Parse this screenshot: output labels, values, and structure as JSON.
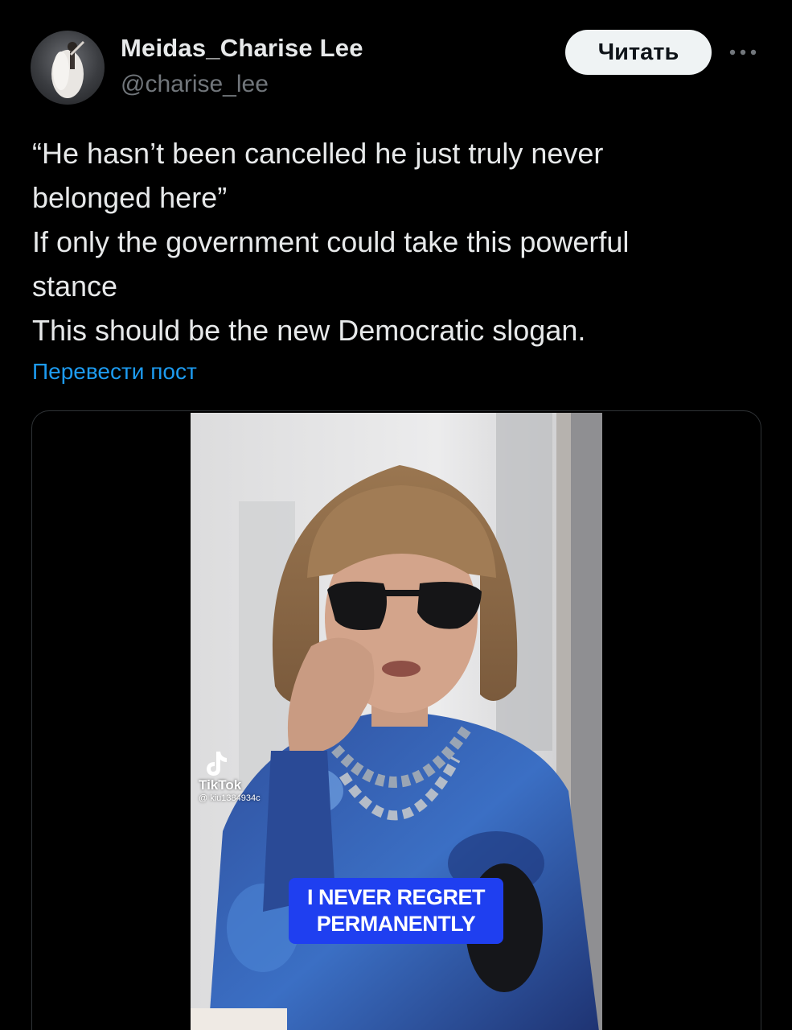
{
  "author": {
    "display_name": "Meidas_Charise Lee",
    "handle": "@charise_lee"
  },
  "follow_button": {
    "label": "Читать"
  },
  "more_button": {
    "icon": "more-horizontal-icon"
  },
  "tweet": {
    "lines": [
      "“He hasn’t been cancelled he just truly never",
      "belonged here”",
      "If only the government could take this powerful",
      "stance",
      "This should be the new Democratic slogan."
    ]
  },
  "translate_link": {
    "label": "Перевести пост"
  },
  "video": {
    "watermark": {
      "brand": "TikTok",
      "user": "@ kiu1384934c"
    },
    "caption": {
      "line1": "I NEVER REGRET",
      "line2": "PERMANENTLY"
    }
  },
  "colors": {
    "background": "#000000",
    "text_primary": "#e7e9ea",
    "text_secondary": "#71767b",
    "link": "#1d9bf0",
    "caption_bg": "#1f3ff0"
  }
}
